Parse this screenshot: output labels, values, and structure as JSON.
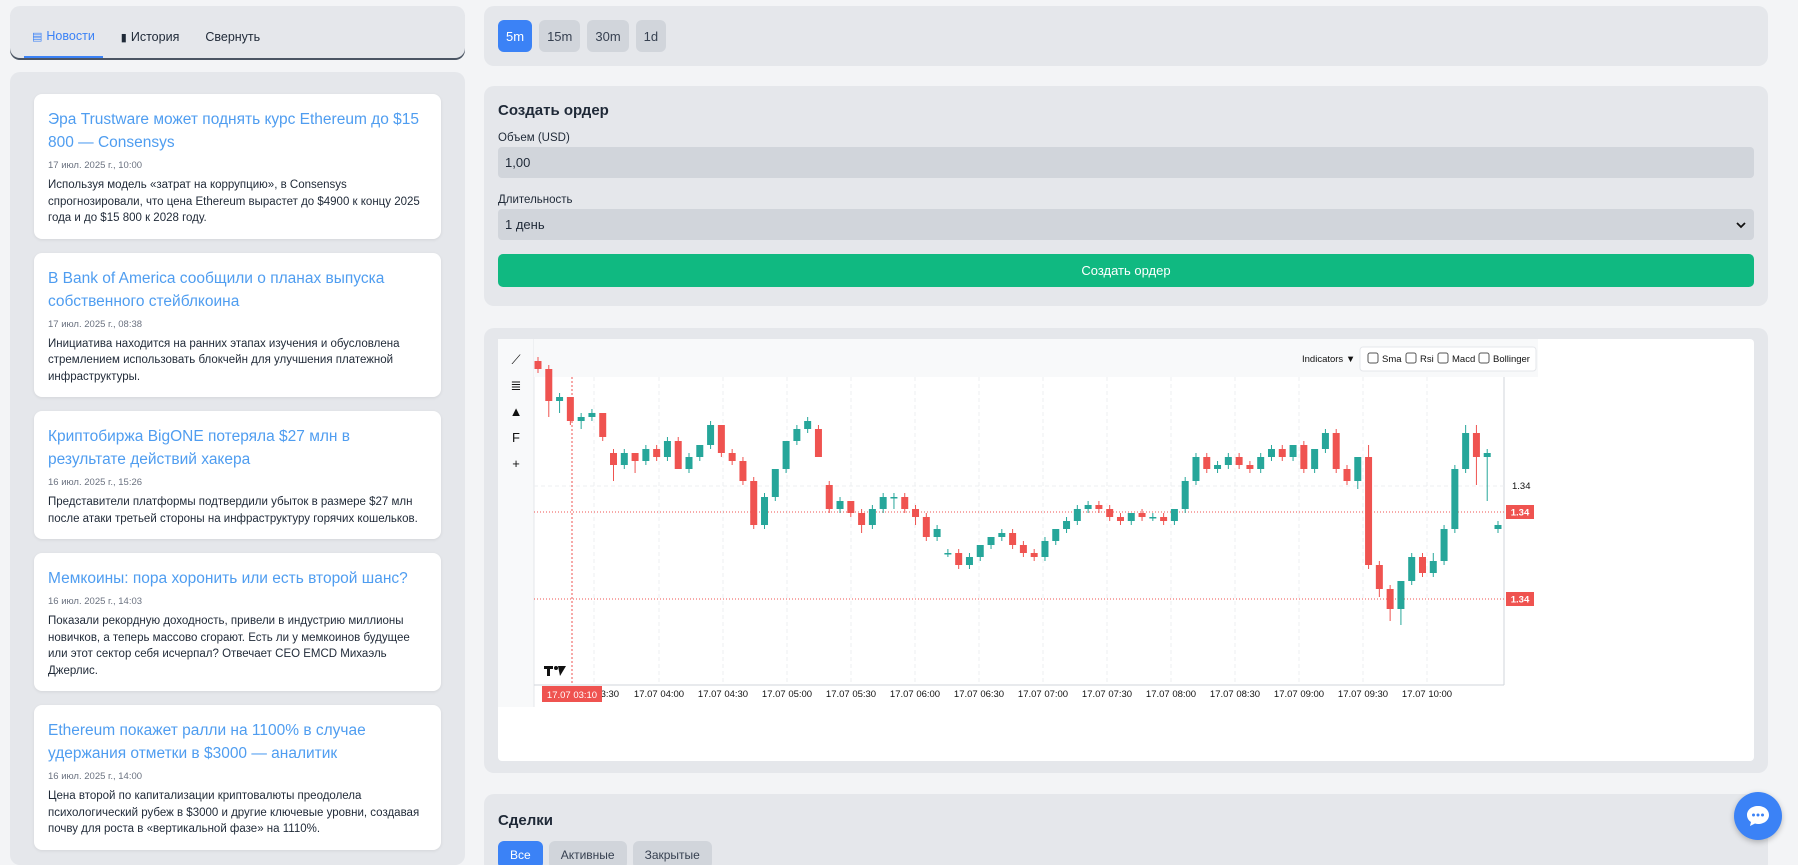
{
  "tabs": [
    {
      "label": "Новости",
      "icon": "news-icon",
      "active": true
    },
    {
      "label": "История",
      "icon": "book-icon",
      "active": false
    },
    {
      "label": "Свернуть",
      "icon": "",
      "active": false
    }
  ],
  "news": [
    {
      "title": "Эра Trustware может поднять курс Ethereum до $15 800 — Consensys",
      "date": "17 июл. 2025 г., 10:00",
      "text": "Используя модель «затрат на коррупцию», в Consensys спрогнозировали, что цена Ethereum вырастет до $4900 к концу 2025 года и до $15 800 к 2028 году."
    },
    {
      "title": "В Bank of America сообщили о планах выпуска собственного стейблкоина",
      "date": "17 июл. 2025 г., 08:38",
      "text": "Инициатива находится на ранних этапах изучения и обусловлена стремлением использовать блокчейн для улучшения платежной инфраструктуры."
    },
    {
      "title": "Криптобиржа BigONE потеряла $27 млн в результате действий хакера",
      "date": "16 июл. 2025 г., 15:26",
      "text": "Представители платформы подтвердили убыток в размере $27 млн после атаки третьей стороны на инфраструктуру горячих кошельков."
    },
    {
      "title": "Мемкоины: пора хоронить или есть второй шанс?",
      "date": "16 июл. 2025 г., 14:03",
      "text": "Показали рекордную доходность, привели в индустрию миллионы новичков, а теперь массово сгорают. Есть ли у мемкоинов будущее или этот сектор себя исчерпал? Отвечает CEO EMCD Михаэль Джерлис."
    },
    {
      "title": "Ethereum покажет ралли на 1100% в случае удержания отметки в $3000 — аналитик",
      "date": "16 июл. 2025 г., 14:00",
      "text": "Цена второй по капитализации криптовалюты преодолела психологический рубеж в $3000 и другие ключевые уровни, создавая почву для роста в «вертикальной фазе» на 1110%."
    }
  ],
  "timeframes": [
    {
      "label": "5m",
      "active": true
    },
    {
      "label": "15m",
      "active": false
    },
    {
      "label": "30m",
      "active": false
    },
    {
      "label": "1d",
      "active": false
    }
  ],
  "order": {
    "title": "Создать ордер",
    "volume_label": "Объем (USD)",
    "volume_value": "1,00",
    "duration_label": "Длительность",
    "duration_value": "1 день",
    "submit_label": "Создать ордер"
  },
  "chart_toolbar": {
    "indicators_label": "Indicators ▼",
    "checkboxes": [
      "Sma",
      "Rsi",
      "Macd",
      "Bollinger"
    ],
    "tools": [
      "line-tool-icon",
      "horizontal-lines-icon",
      "triangle-icon",
      "fib-icon",
      "crosshair-icon"
    ],
    "tool_glyphs": [
      "⟋",
      "≣",
      "▲",
      "F",
      "+"
    ]
  },
  "chart_data": {
    "type": "candlestick",
    "x_ticks": [
      "17.07 03:30",
      "17.07 04:00",
      "17.07 04:30",
      "17.07 05:00",
      "17.07 05:30",
      "17.07 06:00",
      "17.07 06:30",
      "17.07 07:00",
      "17.07 07:30",
      "17.07 08:00",
      "17.07 08:30",
      "17.07 09:00",
      "17.07 09:30",
      "17.07 10:00"
    ],
    "y_tick": "1.34",
    "price_labels": [
      "1.34",
      "1.34"
    ],
    "crosshair_label": "17.07 03:10",
    "up_color": "#26a69a",
    "down_color": "#ef5350",
    "candles": [
      [
        0.62,
        0.6,
        0.63,
        0.59
      ],
      [
        0.6,
        0.52,
        0.61,
        0.48
      ],
      [
        0.52,
        0.53,
        0.54,
        0.49
      ],
      [
        0.53,
        0.47,
        0.53,
        0.46
      ],
      [
        0.47,
        0.48,
        0.49,
        0.45
      ],
      [
        0.48,
        0.49,
        0.5,
        0.47
      ],
      [
        0.49,
        0.43,
        0.49,
        0.42
      ],
      [
        0.39,
        0.36,
        0.4,
        0.32
      ],
      [
        0.36,
        0.39,
        0.4,
        0.35
      ],
      [
        0.39,
        0.37,
        0.39,
        0.34
      ],
      [
        0.37,
        0.4,
        0.41,
        0.36
      ],
      [
        0.4,
        0.38,
        0.41,
        0.37
      ],
      [
        0.38,
        0.42,
        0.43,
        0.37
      ],
      [
        0.42,
        0.35,
        0.43,
        0.35
      ],
      [
        0.35,
        0.38,
        0.39,
        0.34
      ],
      [
        0.38,
        0.41,
        0.41,
        0.37
      ],
      [
        0.41,
        0.46,
        0.47,
        0.4
      ],
      [
        0.46,
        0.39,
        0.46,
        0.38
      ],
      [
        0.39,
        0.37,
        0.4,
        0.36
      ],
      [
        0.37,
        0.32,
        0.38,
        0.31
      ],
      [
        0.32,
        0.21,
        0.33,
        0.2
      ],
      [
        0.21,
        0.28,
        0.29,
        0.2
      ],
      [
        0.28,
        0.35,
        0.35,
        0.27
      ],
      [
        0.35,
        0.42,
        0.42,
        0.34
      ],
      [
        0.42,
        0.45,
        0.46,
        0.41
      ],
      [
        0.45,
        0.47,
        0.48,
        0.44
      ],
      [
        0.45,
        0.38,
        0.46,
        0.38
      ],
      [
        0.31,
        0.25,
        0.32,
        0.24
      ],
      [
        0.25,
        0.27,
        0.28,
        0.24
      ],
      [
        0.27,
        0.24,
        0.27,
        0.23
      ],
      [
        0.24,
        0.21,
        0.25,
        0.19
      ],
      [
        0.21,
        0.25,
        0.26,
        0.2
      ],
      [
        0.25,
        0.28,
        0.29,
        0.24
      ],
      [
        0.28,
        0.28,
        0.29,
        0.25
      ],
      [
        0.28,
        0.25,
        0.29,
        0.24
      ],
      [
        0.25,
        0.23,
        0.26,
        0.21
      ],
      [
        0.23,
        0.18,
        0.24,
        0.17
      ],
      [
        0.18,
        0.2,
        0.21,
        0.17
      ],
      [
        0.14,
        0.14,
        0.15,
        0.13
      ],
      [
        0.14,
        0.11,
        0.15,
        0.1
      ],
      [
        0.11,
        0.13,
        0.14,
        0.1
      ],
      [
        0.13,
        0.16,
        0.16,
        0.12
      ],
      [
        0.16,
        0.18,
        0.18,
        0.15
      ],
      [
        0.18,
        0.19,
        0.2,
        0.17
      ],
      [
        0.19,
        0.16,
        0.2,
        0.15
      ],
      [
        0.16,
        0.14,
        0.17,
        0.13
      ],
      [
        0.14,
        0.13,
        0.15,
        0.12
      ],
      [
        0.13,
        0.17,
        0.18,
        0.12
      ],
      [
        0.17,
        0.2,
        0.2,
        0.16
      ],
      [
        0.2,
        0.22,
        0.23,
        0.19
      ],
      [
        0.22,
        0.25,
        0.26,
        0.21
      ],
      [
        0.25,
        0.26,
        0.27,
        0.24
      ],
      [
        0.26,
        0.25,
        0.27,
        0.24
      ],
      [
        0.25,
        0.23,
        0.26,
        0.22
      ],
      [
        0.23,
        0.22,
        0.24,
        0.21
      ],
      [
        0.22,
        0.24,
        0.24,
        0.21
      ],
      [
        0.24,
        0.23,
        0.25,
        0.22
      ],
      [
        0.23,
        0.23,
        0.24,
        0.22
      ],
      [
        0.23,
        0.22,
        0.24,
        0.21
      ],
      [
        0.22,
        0.25,
        0.25,
        0.21
      ],
      [
        0.25,
        0.32,
        0.33,
        0.24
      ],
      [
        0.32,
        0.38,
        0.39,
        0.31
      ],
      [
        0.38,
        0.35,
        0.39,
        0.34
      ],
      [
        0.35,
        0.36,
        0.37,
        0.34
      ],
      [
        0.36,
        0.38,
        0.39,
        0.35
      ],
      [
        0.38,
        0.36,
        0.39,
        0.35
      ],
      [
        0.36,
        0.35,
        0.37,
        0.34
      ],
      [
        0.35,
        0.38,
        0.39,
        0.34
      ],
      [
        0.38,
        0.4,
        0.41,
        0.37
      ],
      [
        0.4,
        0.38,
        0.41,
        0.37
      ],
      [
        0.38,
        0.41,
        0.41,
        0.37
      ],
      [
        0.41,
        0.35,
        0.42,
        0.34
      ],
      [
        0.35,
        0.4,
        0.4,
        0.34
      ],
      [
        0.4,
        0.44,
        0.45,
        0.39
      ],
      [
        0.44,
        0.35,
        0.45,
        0.34
      ],
      [
        0.35,
        0.32,
        0.36,
        0.31
      ],
      [
        0.32,
        0.38,
        0.38,
        0.3
      ],
      [
        0.38,
        0.11,
        0.41,
        0.1
      ],
      [
        0.11,
        0.05,
        0.12,
        0.03
      ],
      [
        0.05,
        0.0,
        0.06,
        -0.03
      ],
      [
        0.0,
        0.07,
        0.07,
        -0.04
      ],
      [
        0.07,
        0.13,
        0.14,
        0.06
      ],
      [
        0.13,
        0.09,
        0.14,
        0.08
      ],
      [
        0.09,
        0.12,
        0.14,
        0.08
      ],
      [
        0.12,
        0.2,
        0.21,
        0.11
      ],
      [
        0.2,
        0.35,
        0.36,
        0.19
      ],
      [
        0.35,
        0.44,
        0.46,
        0.34
      ],
      [
        0.44,
        0.38,
        0.46,
        0.31
      ],
      [
        0.38,
        0.39,
        0.4,
        0.27
      ],
      [
        0.2,
        0.21,
        0.22,
        0.19
      ]
    ]
  },
  "deals": {
    "title": "Сделки",
    "tabs": [
      "Все",
      "Активные",
      "Закрытые"
    ]
  }
}
